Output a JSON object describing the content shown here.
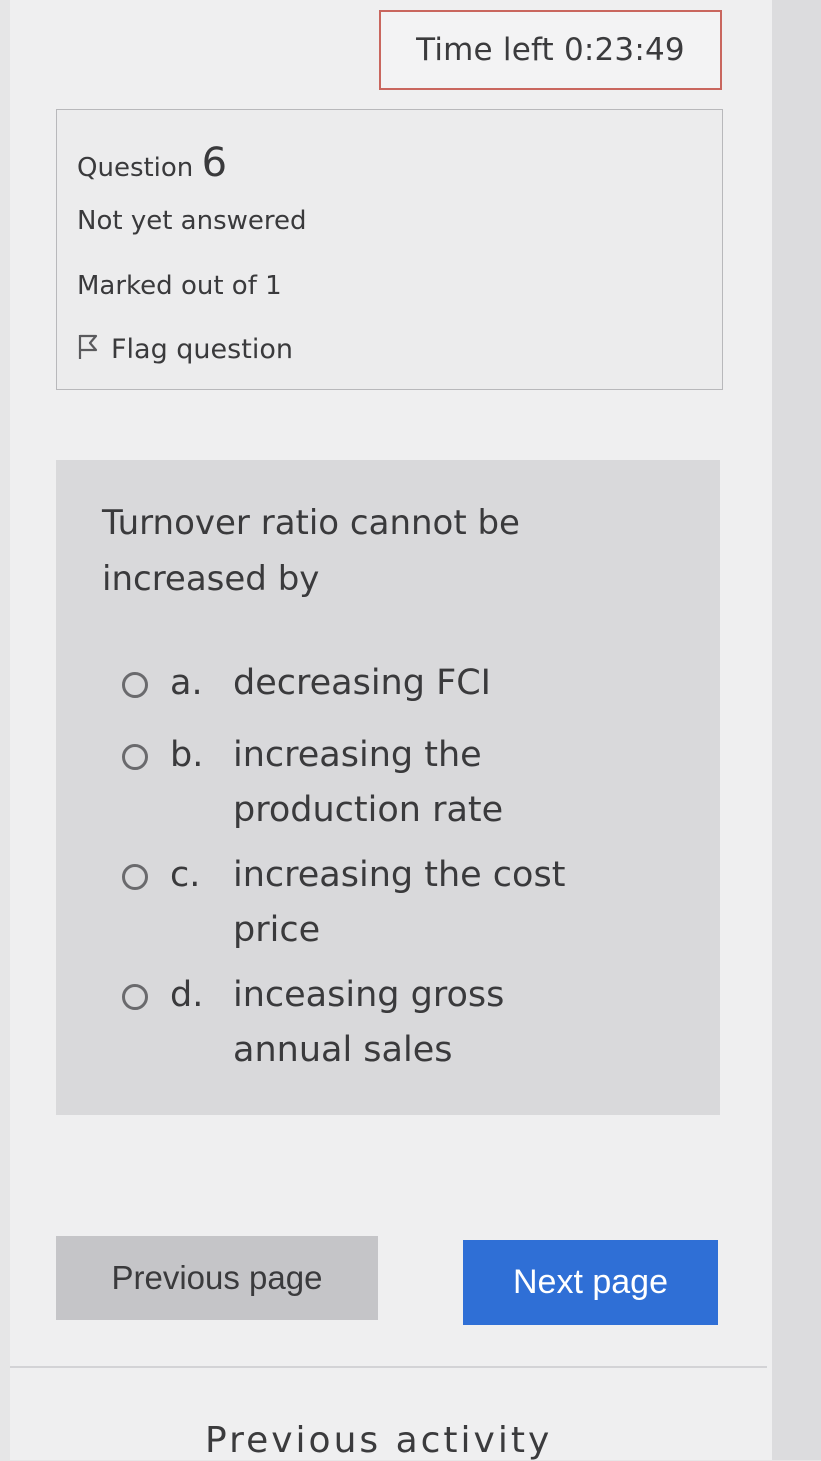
{
  "timer": {
    "label": "Time left 0:23:49"
  },
  "info": {
    "question_prefix": "Question ",
    "question_number": "6",
    "status": "Not yet answered",
    "marks": "Marked out of 1",
    "flag_label": "Flag question"
  },
  "question": {
    "text": "Turnover ratio cannot be increased by",
    "options": [
      {
        "letter": "a.",
        "text": "decreasing FCI"
      },
      {
        "letter": "b.",
        "text": "increasing the production rate"
      },
      {
        "letter": "c.",
        "text": "increasing the cost price"
      },
      {
        "letter": "d.",
        "text": "inceasing gross annual sales"
      }
    ]
  },
  "nav": {
    "prev_label": "Previous page",
    "next_label": "Next page",
    "prev_activity": "Previous activity"
  },
  "colors": {
    "next_button": "#2f6fd6",
    "prev_button": "#c5c5c8",
    "timer_border": "#c9665e"
  },
  "icons": {
    "flag": "flag-icon",
    "radio": "radio-unchecked-icon"
  }
}
